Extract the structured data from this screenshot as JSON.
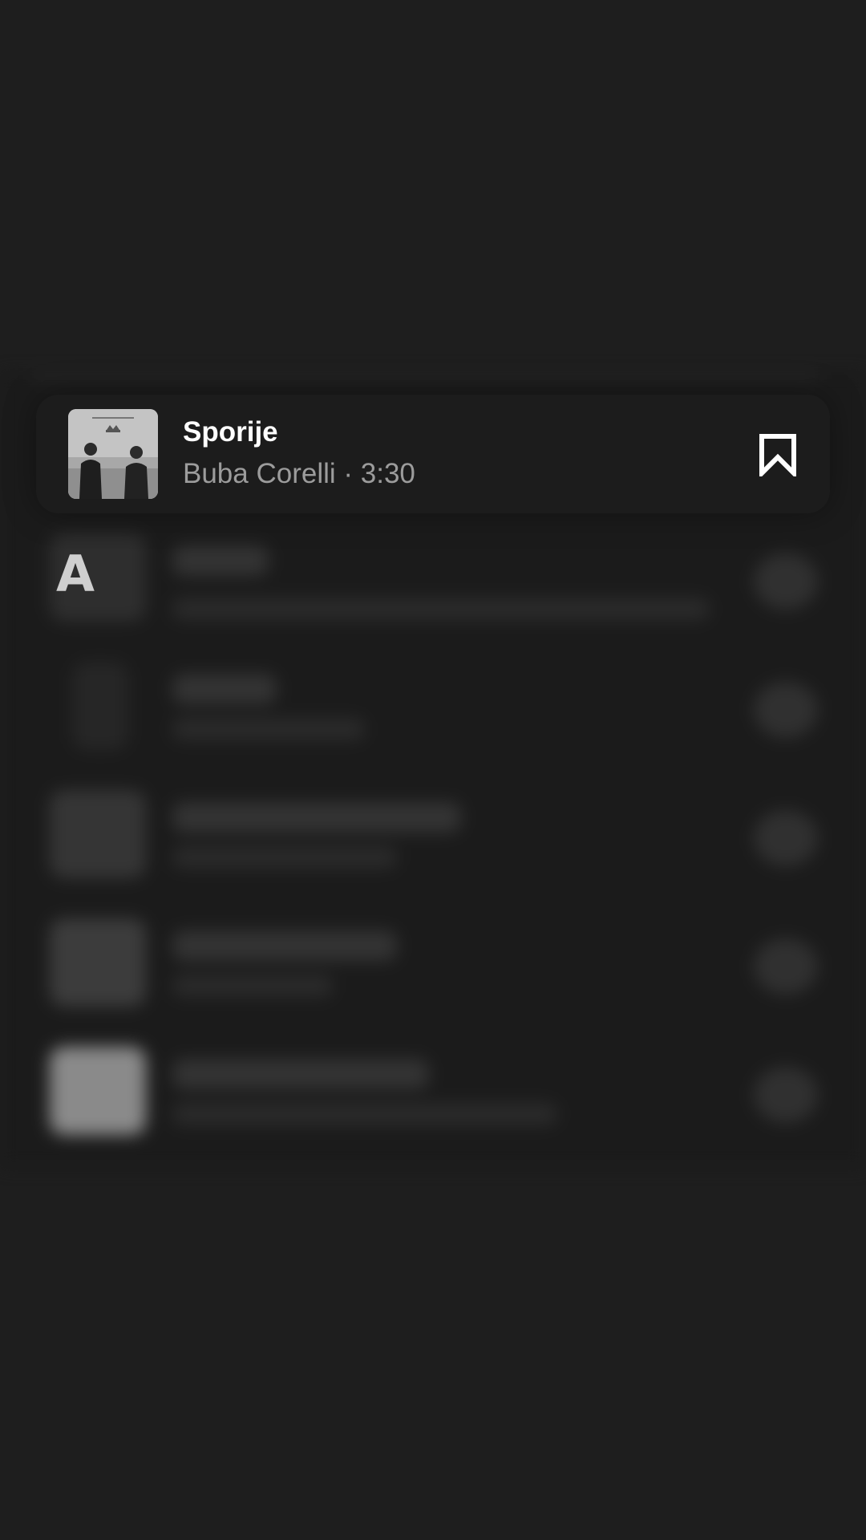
{
  "track": {
    "title": "Sporije",
    "artist": "Buba Corelli",
    "separator": "·",
    "duration": "3:30",
    "artwork_icon": "album-cover-art",
    "action_icon": "bookmark-icon"
  },
  "index": {
    "letter": "A"
  },
  "colors": {
    "background": "#1e1e1e",
    "card": "#1c1c1c",
    "title_text": "#ffffff",
    "subtitle_text": "#9c9c9c"
  }
}
